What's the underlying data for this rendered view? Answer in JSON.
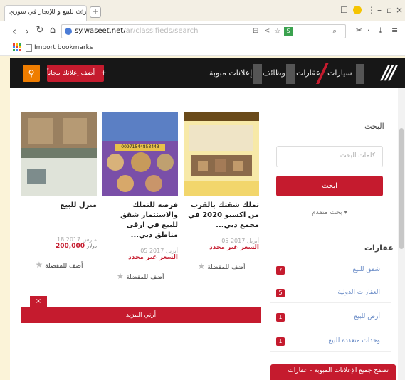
{
  "browser": {
    "tab_title": "عقارات للبيع و للإيجار في سوري",
    "tab_close": "×",
    "newtab": "+",
    "url_main": "sy.waseet.net/",
    "url_rest": "ar/classifieds/search",
    "bookmark_label": "Import bookmarks"
  },
  "site": {
    "logo": "///",
    "nav": {
      "cars": "سيارات",
      "realestate": "عقارات",
      "jobs": "وظائف",
      "ads": "إعلانات مبوبة"
    },
    "post_ad": "أضف إعلانك مجاناً | +",
    "search_icon": "search-icon"
  },
  "sidebar": {
    "search_title": "البحث",
    "search_placeholder": "كلمات البحث",
    "search_button": "ابحث",
    "advanced": "بحث متقدم ▾",
    "categories_title": "عقارات",
    "categories": [
      {
        "label": "شقق للبيع",
        "count": "7"
      },
      {
        "label": "العقارات الدولية",
        "count": "5"
      },
      {
        "label": "أرض للبيع",
        "count": "1"
      },
      {
        "label": "وحدات متعددة للبيع",
        "count": "1"
      }
    ],
    "bottom_button": "تصفح جميع الإعلانات المبوبة - عقارات"
  },
  "cards": [
    {
      "title": "تملك شقتك بالقرب من اكسبو 2020 في مجمع دبي...",
      "date": "05 أبريل 2017",
      "price": "السعر غير محدد",
      "fav": "أضف للمفضلة"
    },
    {
      "title": "فرصة للتملك والاستثمار شقق للبيع في ارقى مناطق دبي...",
      "date": "05 أبريل 2017",
      "price": "السعر غير محدد",
      "fav": "أضف للمفضلة",
      "img_phone": "00971544853443"
    },
    {
      "title": "منزل للبيع",
      "date": "18 مارس 2017",
      "price": "200,000",
      "currency": "دولار",
      "fav": "أضف للمفضلة"
    }
  ],
  "more_button": "أرني المزيد",
  "close_badge": "×",
  "colors": {
    "brand_red": "#c51b2e",
    "orange": "#ef7d00",
    "nav_black": "#171717"
  }
}
